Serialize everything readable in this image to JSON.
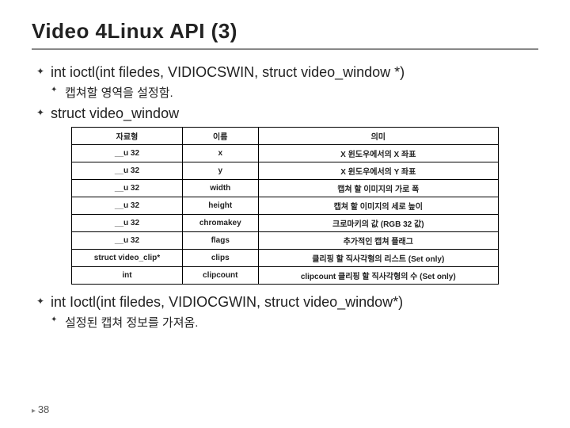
{
  "title": "Video 4Linux API (3)",
  "bullets": {
    "b1": "int ioctl(int filedes, VIDIOCSWIN, struct video_window *)",
    "b1_sub": "캡쳐할 영역을 설정함.",
    "b2": "struct video_window",
    "b3": "int Ioctl(int filedes, VIDIOCGWIN, struct video_window*)",
    "b3_sub": "설정된 캡쳐 정보를 가져옴."
  },
  "table": {
    "headers": [
      "자료형",
      "이름",
      "의미"
    ],
    "rows": [
      [
        "__u 32",
        "x",
        "X 윈도우에서의 X 좌표"
      ],
      [
        "__u 32",
        "y",
        "X 윈도우에서의 Y 좌표"
      ],
      [
        "__u 32",
        "width",
        "캡쳐 할 이미지의 가로 폭"
      ],
      [
        "__u 32",
        "height",
        "캡쳐 할 이미지의 세로 높이"
      ],
      [
        "__u 32",
        "chromakey",
        "크로마키의 값 (RGB 32 값)"
      ],
      [
        "__u 32",
        "flags",
        "추가적인 캡쳐 플래그"
      ],
      [
        "struct video_clip*",
        "clips",
        "클리핑 할 직사각형의 리스트 (Set only)"
      ],
      [
        "int",
        "clipcount",
        "clipcount 클리핑 할 직사각형의 수 (Set only)"
      ]
    ]
  },
  "page": "38"
}
